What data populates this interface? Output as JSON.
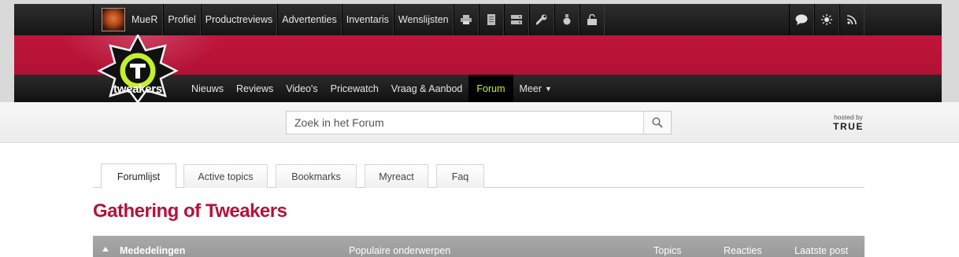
{
  "topbar": {
    "username": "MueR",
    "menu": [
      "Profiel",
      "Productreviews",
      "Advertenties",
      "Inventaris",
      "Wenslijsten"
    ],
    "icons_left": [
      "printer-icon",
      "document-icon",
      "server-icon",
      "wrench-icon",
      "medal-icon",
      "unlock-icon"
    ],
    "icons_right": [
      "chat-bubble-icon",
      "sun-icon",
      "rss-icon"
    ]
  },
  "logo": {
    "text": "tweakers"
  },
  "nav": {
    "items": [
      "Nieuws",
      "Reviews",
      "Video's",
      "Pricewatch",
      "Vraag & Aanbod",
      "Forum",
      "Meer"
    ],
    "active": "Forum"
  },
  "search": {
    "placeholder": "Zoek in het Forum"
  },
  "hosted": {
    "label": "hosted by",
    "brand": "TRUE"
  },
  "tabs": [
    "Forumlijst",
    "Active topics",
    "Bookmarks",
    "Myreact",
    "Faq"
  ],
  "page": {
    "title": "Gathering of Tweakers"
  },
  "table": {
    "section": "Mededelingen",
    "columns": [
      "Populaire onderwerpen",
      "Topics",
      "Reacties",
      "Laatste post"
    ]
  },
  "colors": {
    "brand_red": "#b5123a",
    "active_nav_text": "#c8f03a",
    "banner_red": "#c0153c"
  }
}
